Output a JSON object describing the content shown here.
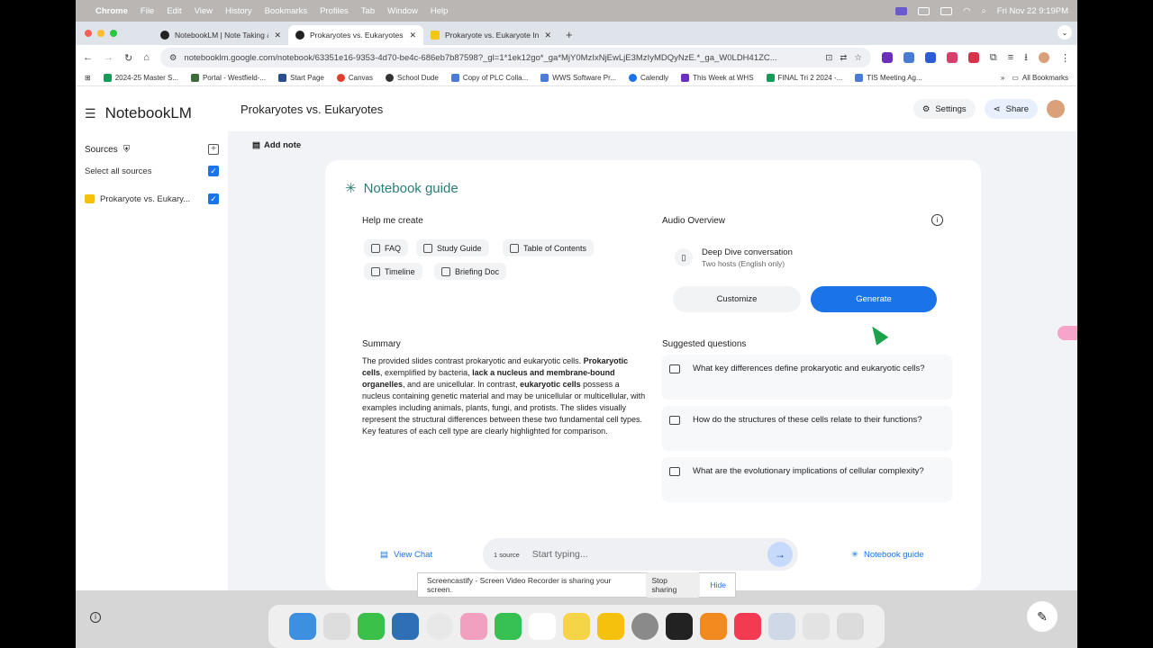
{
  "menubar": {
    "app": "Chrome",
    "items": [
      "File",
      "Edit",
      "View",
      "History",
      "Bookmarks",
      "Profiles",
      "Tab",
      "Window",
      "Help"
    ],
    "clock": "Fri Nov 22  9:19PM"
  },
  "tabs": [
    {
      "label": "NotebookLM | Note Taking &",
      "active": false
    },
    {
      "label": "Prokaryotes vs. Eukaryotes -",
      "active": true
    },
    {
      "label": "Prokaryote vs. Eukaryote Info",
      "active": false
    }
  ],
  "address": {
    "url": "notebooklm.google.com/notebook/63351e16-9353-4d70-be4c-686eb7b87598?_gl=1*1ek12go*_ga*MjY0MzIxNjEwLjE3MzIyMDQyNzE.*_ga_W0LDH41ZC..."
  },
  "bookmarks": [
    "2024-25 Master S...",
    "Portal - Westfield-...",
    "Start Page",
    "Canvas",
    "School Dude",
    "Copy of PLC Colla...",
    "WWS Software Pr...",
    "Calendly",
    "This Week at WHS",
    "FINAL Tri 2 2024 -...",
    "TIS Meeting Ag..."
  ],
  "bookmarks_all": "All Bookmarks",
  "app": {
    "logo": "NotebookLM",
    "notebook_title": "Prokaryotes vs. Eukaryotes",
    "settings": "Settings",
    "share": "Share",
    "add_note": "Add note",
    "sidebar": {
      "sources": "Sources",
      "select_all": "Select all sources",
      "source_item": "Prokaryote vs. Eukary..."
    },
    "guide": {
      "title": "Notebook guide",
      "help_label": "Help me create",
      "chips": [
        "FAQ",
        "Study Guide",
        "Table of Contents",
        "Timeline",
        "Briefing Doc"
      ],
      "audio_label": "Audio Overview",
      "deep_title": "Deep Dive conversation",
      "deep_sub": "Two hosts (English only)",
      "customize": "Customize",
      "generate": "Generate",
      "summary_label": "Summary",
      "summary": {
        "p1": "The provided slides contrast prokaryotic and eukaryotic cells. ",
        "b1": "Prokaryotic cells",
        "p2": ", exemplified by bacteria, ",
        "b2": "lack a nucleus and membrane-bound organelles",
        "p3": ", and are unicellular. In contrast, ",
        "b3": "eukaryotic cells",
        "p4": " possess a nucleus containing genetic material and may be unicellular or multicellular, with examples including animals, plants, fungi, and protists. The slides visually represent the structural differences between these two fundamental cell types. Key features of each cell type are clearly highlighted for comparison."
      },
      "suggested_label": "Suggested questions",
      "questions": [
        "What key differences define prokaryotic and eukaryotic cells?",
        "How do the structures of these cells relate to their functions?",
        "What are the evolutionary implications of cellular complexity?"
      ]
    },
    "bottom": {
      "view_chat": "View Chat",
      "source_count": "1 source",
      "placeholder": "Start typing...",
      "notebook_guide": "Notebook guide"
    }
  },
  "screencastify": {
    "text": "Screencastify - Screen Video Recorder is sharing your screen.",
    "stop": "Stop sharing",
    "hide": "Hide"
  },
  "colors": {
    "accent": "#1a73e8",
    "guide_title": "#2a7d77"
  }
}
